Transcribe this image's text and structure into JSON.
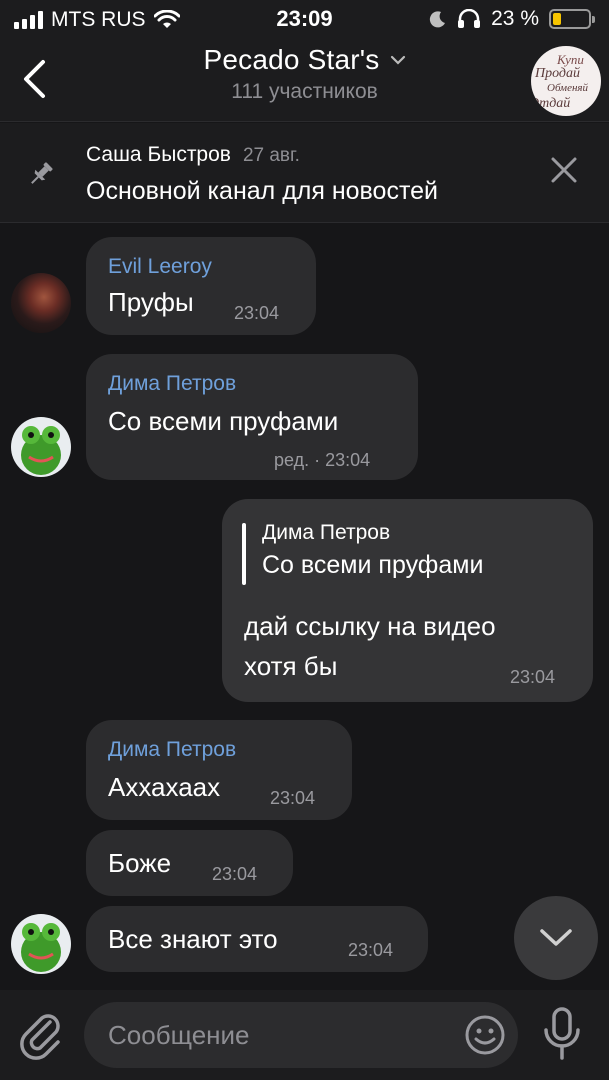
{
  "status_bar": {
    "carrier": "MTS RUS",
    "time": "23:09",
    "battery": "23 %",
    "battery_level": 0.23,
    "battery_color": "#f7c500"
  },
  "header": {
    "back_icon": "chevron-left-icon",
    "title": "Pecado Star's",
    "subtitle": "111 участников",
    "avatar_lines": [
      "Купи",
      "Продай",
      "Обменяй",
      "Отдай"
    ]
  },
  "pinned": {
    "author": "Саша Быстров",
    "date": "27 авг.",
    "text": "Основной канал для новостей"
  },
  "messages": [
    {
      "sender": "Evil Leeroy",
      "text": "Пруфы",
      "time": "23:04"
    },
    {
      "sender": "Дима Петров",
      "text": "Со всеми пруфами",
      "time": "ред. · 23:04"
    },
    {
      "reply_sender": "Дима Петров",
      "reply_text": "Со всеми пруфами",
      "text_line1": "дай ссылку на видео",
      "text_line2": "хотя бы",
      "time": "23:04"
    },
    {
      "sender": "Дима Петров",
      "text": "Аххахаах",
      "time": "23:04"
    },
    {
      "text": "Боже",
      "time": "23:04"
    },
    {
      "text": "Все знают это",
      "time": "23:04"
    }
  ],
  "input": {
    "placeholder": "Сообщение"
  },
  "colors": {
    "background": "#161618",
    "bar": "#1c1c1e",
    "bubble": "#2c2c2e",
    "sender_name": "#6fa0db"
  }
}
